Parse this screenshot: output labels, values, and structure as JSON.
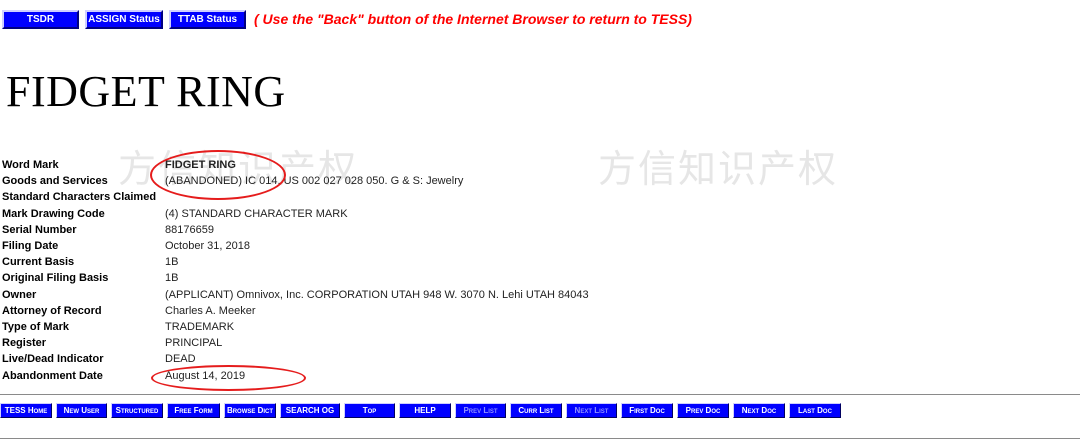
{
  "top_nav": {
    "buttons": [
      "TSDR",
      "ASSIGN Status",
      "TTAB Status"
    ],
    "note": "( Use the \"Back\" button of the Internet Browser to return to TESS)"
  },
  "mark_title": "FIDGET RING",
  "watermark": "方信知识产权",
  "fields": {
    "word_mark": {
      "label": "Word Mark",
      "value": "FIDGET RING"
    },
    "goods_services": {
      "label": "Goods and Services",
      "value": "(ABANDONED) IC 014. US 002 027 028 050. G & S: Jewelry"
    },
    "standard_characters": {
      "label": "Standard Characters Claimed",
      "value": ""
    },
    "mark_drawing_code": {
      "label": "Mark Drawing Code",
      "value": "(4) STANDARD CHARACTER MARK"
    },
    "serial_number": {
      "label": "Serial Number",
      "value": "88176659"
    },
    "filing_date": {
      "label": "Filing Date",
      "value": "October 31, 2018"
    },
    "current_basis": {
      "label": "Current Basis",
      "value": "1B"
    },
    "original_filing_basis": {
      "label": "Original Filing Basis",
      "value": "1B"
    },
    "owner": {
      "label": "Owner",
      "value": "(APPLICANT) Omnivox, Inc. CORPORATION UTAH 948 W. 3070 N. Lehi UTAH 84043"
    },
    "attorney": {
      "label": "Attorney of Record",
      "value": "Charles A. Meeker"
    },
    "type_of_mark": {
      "label": "Type of Mark",
      "value": "TRADEMARK"
    },
    "register": {
      "label": "Register",
      "value": "PRINCIPAL"
    },
    "live_dead": {
      "label": "Live/Dead Indicator",
      "value": "DEAD"
    },
    "abandonment_date": {
      "label": "Abandonment Date",
      "value": "August 14, 2019"
    }
  },
  "bottom_nav": {
    "tess_home": "TESS Home",
    "new_user": "New User",
    "structured": "Structured",
    "free_form": "Free Form",
    "browse_dict": "Browse Dict",
    "search_og": "SEARCH OG",
    "top": "Top",
    "help": "HELP",
    "prev_list": "Prev List",
    "curr_list": "Curr List",
    "next_list": "Next List",
    "first_doc": "First Doc",
    "prev_doc": "Prev Doc",
    "next_doc": "Next Doc",
    "last_doc": "Last Doc"
  },
  "colors": {
    "button_blue": "#0000ff",
    "note_red": "#ff0000",
    "annotation_red": "#e51c1c"
  }
}
